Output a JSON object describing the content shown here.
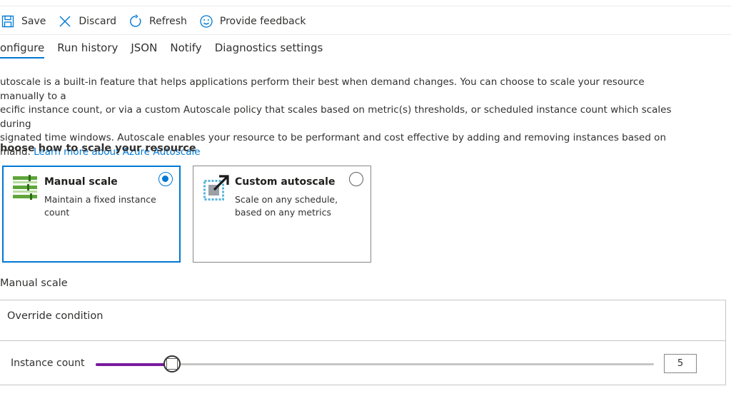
{
  "toolbar": {
    "save": "Save",
    "discard": "Discard",
    "refresh": "Refresh",
    "feedback": "Provide feedback"
  },
  "tabs": [
    "onfigure",
    "Run history",
    "JSON",
    "Notify",
    "Diagnostics settings"
  ],
  "description": {
    "line1": "utoscale is a built-in feature that helps applications perform their best when demand changes. You can choose to scale your resource manually to a",
    "line2": "ecific instance count, or via a custom Autoscale policy that scales based on metric(s) thresholds, or scheduled instance count which scales during",
    "line3": "signated time windows. Autoscale enables your resource to be performant and cost effective by adding and removing instances based on",
    "line4_prefix": "mand.",
    "link": "Learn more about Azure Autoscale"
  },
  "scale_section": {
    "title": "hoose how to scale your resource",
    "manual": {
      "title": "Manual scale",
      "description": "Maintain a fixed instance count",
      "selected": true,
      "icon": "manual-scale-icon"
    },
    "custom": {
      "title": "Custom autoscale",
      "description": "Scale on any schedule, based on any metrics",
      "selected": false,
      "icon": "custom-autoscale-icon"
    }
  },
  "manual_scale": {
    "label": "Manual scale",
    "override_condition": "Override condition",
    "instance_count_label": "Instance count",
    "instance_count": "5",
    "slider_fraction": 0.137
  },
  "colors": {
    "accent": "#0078d4",
    "slider_fill": "#7a1a9e"
  }
}
